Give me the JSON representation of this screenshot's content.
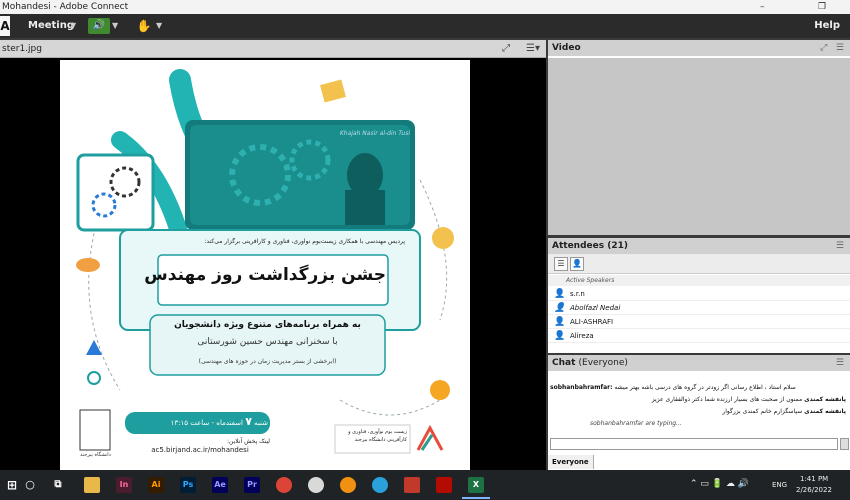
{
  "window": {
    "title_fragment": "Mohandesi - Adobe Connect"
  },
  "menubar": {
    "menu_label": "Meeting",
    "help_label": "Help"
  },
  "share_pod": {
    "filename": "ster1.jpg"
  },
  "poster": {
    "latin_name": "Khajah Nasir al-din Tusi",
    "intro": "پردیس مهندسی با همکاری زیست‌بوم نوآوری، فناوری و کارآفرینی برگزار می‌کند:",
    "headline": "جشن بزرگداشت روز مهندس",
    "sub1": "به همراه برنامه‌های متنوع ویژه دانشجویان",
    "sub2": "با سخنرانی مهندس حسین شورستانی",
    "sub3": "(آبرخشی از بستر مدیریت زمان در حوزه های مهندسی)",
    "day": "شنبه",
    "day_num": "۷",
    "month": "اسفندماه",
    "time_label": "ساعت",
    "time": "۱۳:۱۵",
    "online_label": "لینک پخش آنلاین:",
    "url": "ac5.birjand.ac.ir/mohandesi",
    "org_text": "زیست بوم نوآوری، فناوری و کارآفرینی دانشگاه بیرجند",
    "univ_text": "دانشگاه بیرجند"
  },
  "video_pod": {
    "title": "Video"
  },
  "attendees": {
    "title": "Attendees",
    "count": "(21)",
    "section_label": "Active Speakers",
    "rows": [
      "s.r.n",
      "Abolfazl Nedai",
      "ALI-ASHRAFI",
      "Alireza"
    ]
  },
  "chat": {
    "title": "Chat",
    "scope": "(Everyone)",
    "tab_label": "Everyone",
    "sender": "sobhanbahramfar:",
    "messages": [
      "سلام استاد ، اطلاع رسانی اگر زودتر در گروه های درسی باشه بهتر میشه",
      "ممنون از صحبت های بسیار ارزنده شما دکتر ذوالفقاری عزیز",
      "سپاسگزارم خانم کمندی بزرگوار",
      "sobhanbahramfar are typing..."
    ],
    "msg_sender_names": [
      "",
      "پانفشه کمندی",
      "پانفشه کمندی",
      ""
    ]
  },
  "taskbar": {
    "lang": "ENG",
    "time": "1:41 PM",
    "date": "2/26/2022",
    "apps": [
      "In",
      "Ai",
      "Ps",
      "Ae",
      "Pr",
      "X"
    ]
  },
  "colors": {
    "accent_teal": "#1b8c8c",
    "audio_green": "#3f8a2e",
    "taskbar": "#1f2326"
  }
}
